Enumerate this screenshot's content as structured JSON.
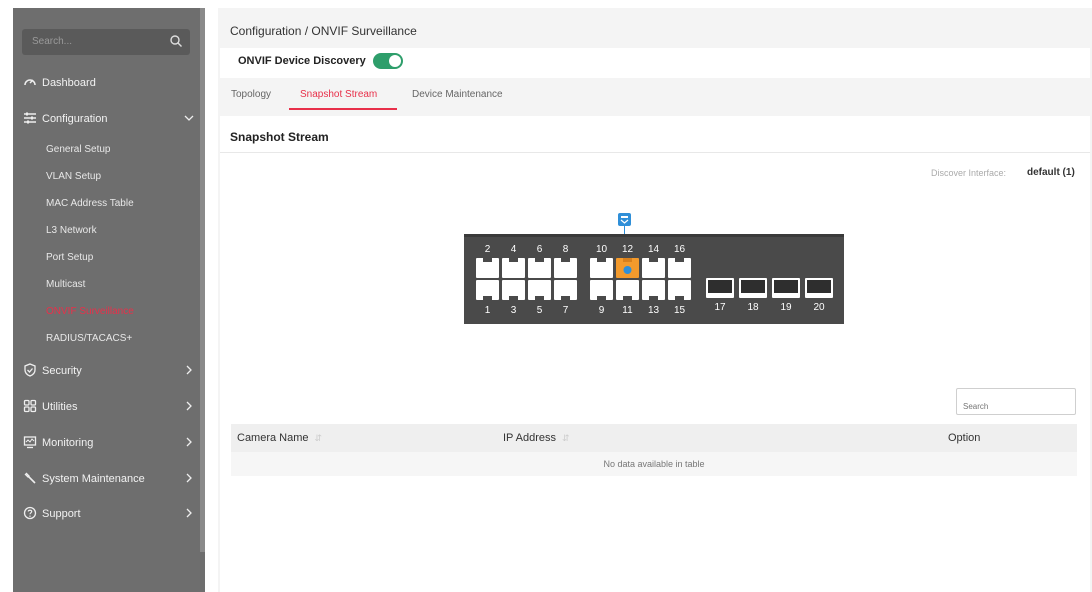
{
  "sidebar": {
    "search_placeholder": "Search...",
    "items": [
      {
        "label": "Dashboard",
        "icon": "dashboard-icon"
      },
      {
        "label": "Configuration",
        "icon": "sliders-icon"
      },
      {
        "label": "Security",
        "icon": "shield-icon"
      },
      {
        "label": "Utilities",
        "icon": "grid-icon"
      },
      {
        "label": "Monitoring",
        "icon": "monitor-icon"
      },
      {
        "label": "System Maintenance",
        "icon": "wrench-icon"
      },
      {
        "label": "Support",
        "icon": "help-icon"
      }
    ],
    "config_sub": [
      "General Setup",
      "VLAN Setup",
      "MAC Address Table",
      "L3 Network",
      "Port Setup",
      "Multicast",
      "ONVIF Surveillance",
      "RADIUS/TACACS+"
    ],
    "active_sub": "ONVIF Surveillance"
  },
  "header": {
    "breadcrumb": "Configuration / ONVIF Surveillance",
    "discovery_label": "ONVIF Device Discovery",
    "discovery_enabled": true
  },
  "tabs": [
    "Topology",
    "Snapshot Stream",
    "Device Maintenance"
  ],
  "active_tab": "Snapshot Stream",
  "panel": {
    "title": "Snapshot Stream",
    "discover_interface_label": "Discover Interface:",
    "discover_interface_value": "default (1)"
  },
  "switch": {
    "top_ports": [
      "2",
      "4",
      "6",
      "8",
      "10",
      "12",
      "14",
      "16"
    ],
    "bottom_ports": [
      "1",
      "3",
      "5",
      "7",
      "9",
      "11",
      "13",
      "15"
    ],
    "sfp_ports": [
      "17",
      "18",
      "19",
      "20"
    ],
    "highlighted_port": "12"
  },
  "table": {
    "search_placeholder": "Search",
    "columns": [
      "Camera Name",
      "IP Address",
      "Option"
    ],
    "rows": [],
    "empty_message": "No data available in table"
  },
  "colors": {
    "accent": "#e8304a",
    "toggle_on": "#2e9e6b",
    "sidebar_bg": "#6e6e6e",
    "port_highlight": "#f39a2c",
    "uplink_icon": "#2f8fd8"
  }
}
